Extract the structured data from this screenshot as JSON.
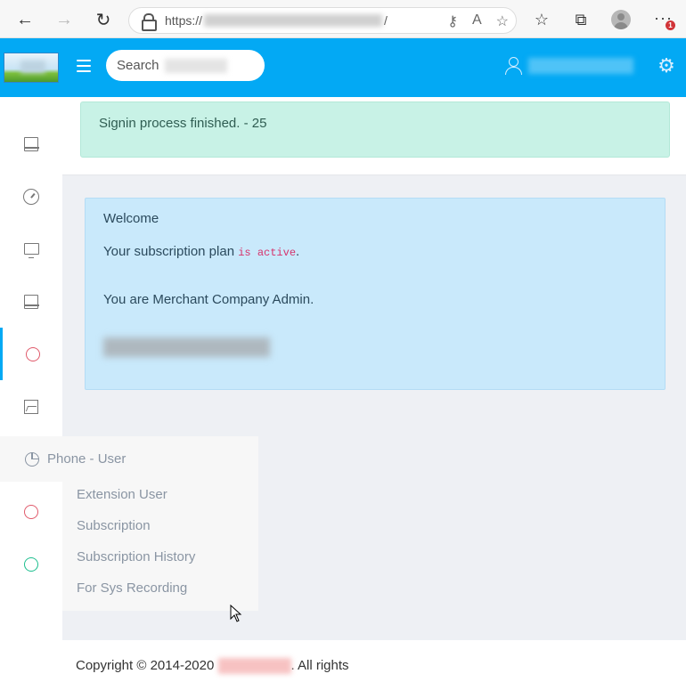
{
  "browser": {
    "url_prefix": "https://",
    "url_suffix": "/",
    "notification_count": "1"
  },
  "header": {
    "search_placeholder": "Search",
    "accent_color": "#03a9f4"
  },
  "alert": {
    "message": "Signin process finished. - 25"
  },
  "welcome": {
    "title": "Welcome",
    "plan_prefix": "Your subscription plan ",
    "plan_status": "is active",
    "plan_suffix": ".",
    "role_text": "You are Merchant Company Admin."
  },
  "sidebar": {
    "items": [
      {
        "icon": "laptop-icon"
      },
      {
        "icon": "gauge-icon"
      },
      {
        "icon": "monitor-icon"
      },
      {
        "icon": "laptop-icon"
      },
      {
        "icon": "circle-icon",
        "active": true
      },
      {
        "icon": "images-icon"
      },
      {
        "icon": "pie-icon"
      },
      {
        "icon": "circle-icon"
      },
      {
        "icon": "circle-icon"
      }
    ]
  },
  "submenu": {
    "title": "Phone - User",
    "items": [
      {
        "label": "Extension User"
      },
      {
        "label": "Subscription"
      },
      {
        "label": "Subscription History"
      },
      {
        "label": "For Sys Recording"
      }
    ]
  },
  "footer": {
    "copyright": "Copyright © 2014-2020 ",
    "rights": ". All rights"
  }
}
